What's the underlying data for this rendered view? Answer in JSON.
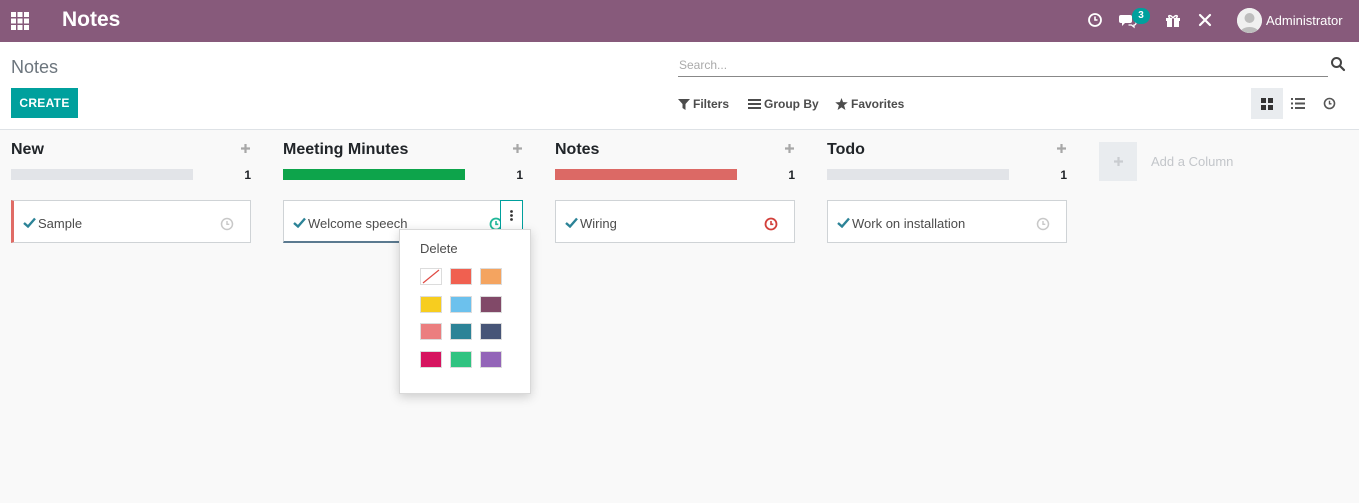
{
  "navbar": {
    "app_title": "Notes",
    "chat_count": "3",
    "user_name": "Administrator",
    "color": "#875a7b"
  },
  "control": {
    "breadcrumb": "Notes",
    "create_label": "CREATE",
    "search_placeholder": "Search...",
    "filters_label": "Filters",
    "group_by_label": "Group By",
    "favorites_label": "Favorites"
  },
  "columns": [
    {
      "title": "New",
      "count": "1",
      "progress_fraction": 0,
      "progress_color": "#e2e4e8",
      "card": {
        "title": "Sample",
        "accent_color": "#e06c66",
        "clock_color": "#c8c8c8"
      }
    },
    {
      "title": "Meeting Minutes",
      "count": "1",
      "progress_fraction": 1,
      "progress_color": "#0da44b",
      "card": {
        "title": "Welcome speech",
        "accent_color": "#5b7a90",
        "clock_color": "#21b799"
      }
    },
    {
      "title": "Notes",
      "count": "1",
      "progress_fraction": 1,
      "progress_color": "#dc6965",
      "card": {
        "title": "Wiring",
        "accent_color": "",
        "clock_color": "#d23f3a"
      }
    },
    {
      "title": "Todo",
      "count": "1",
      "progress_fraction": 0,
      "progress_color": "#e2e4e8",
      "card": {
        "title": "Work on installation",
        "accent_color": "",
        "clock_color": "#c8c8c8"
      }
    }
  ],
  "add_column_label": "Add a Column",
  "dropdown": {
    "delete_label": "Delete",
    "colors": [
      "none",
      "#f06050",
      "#f4a460",
      "#f7cd1f",
      "#6cc1ed",
      "#814968",
      "#eb7e7f",
      "#2c8397",
      "#475577",
      "#d6145f",
      "#30c381",
      "#9365b8"
    ]
  },
  "accent": "#00a09d"
}
